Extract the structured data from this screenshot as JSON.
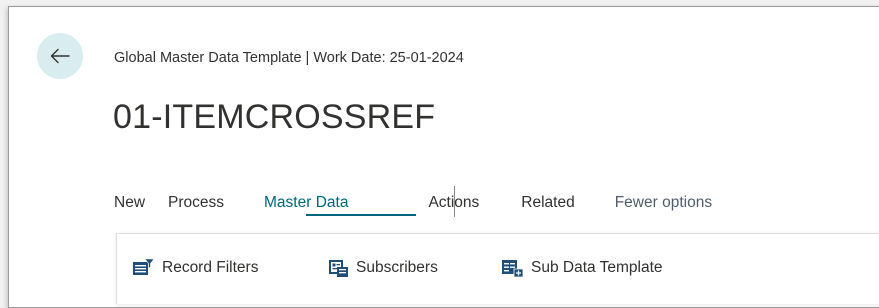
{
  "header": {
    "breadcrumb": "Global Master Data Template | Work Date: 25-01-2024",
    "title": "01-ITEMCROSSREF"
  },
  "back_button": {
    "icon": "arrow-left-icon"
  },
  "action_bar": {
    "items": [
      {
        "label": "New"
      },
      {
        "label": "Process"
      },
      {
        "label": "Master Data",
        "active": true
      },
      {
        "label": "Actions"
      },
      {
        "label": "Related"
      },
      {
        "label": "Fewer options"
      }
    ]
  },
  "sub_actions": [
    {
      "label": "Record Filters",
      "icon": "record-filters-icon"
    },
    {
      "label": "Subscribers",
      "icon": "subscribers-icon"
    },
    {
      "label": "Sub Data Template",
      "icon": "sub-data-template-icon"
    }
  ],
  "colors": {
    "accent": "#00667e",
    "back_button_bg": "#d9ecef",
    "icon_blue": "#1f4e79",
    "text": "#323130"
  }
}
